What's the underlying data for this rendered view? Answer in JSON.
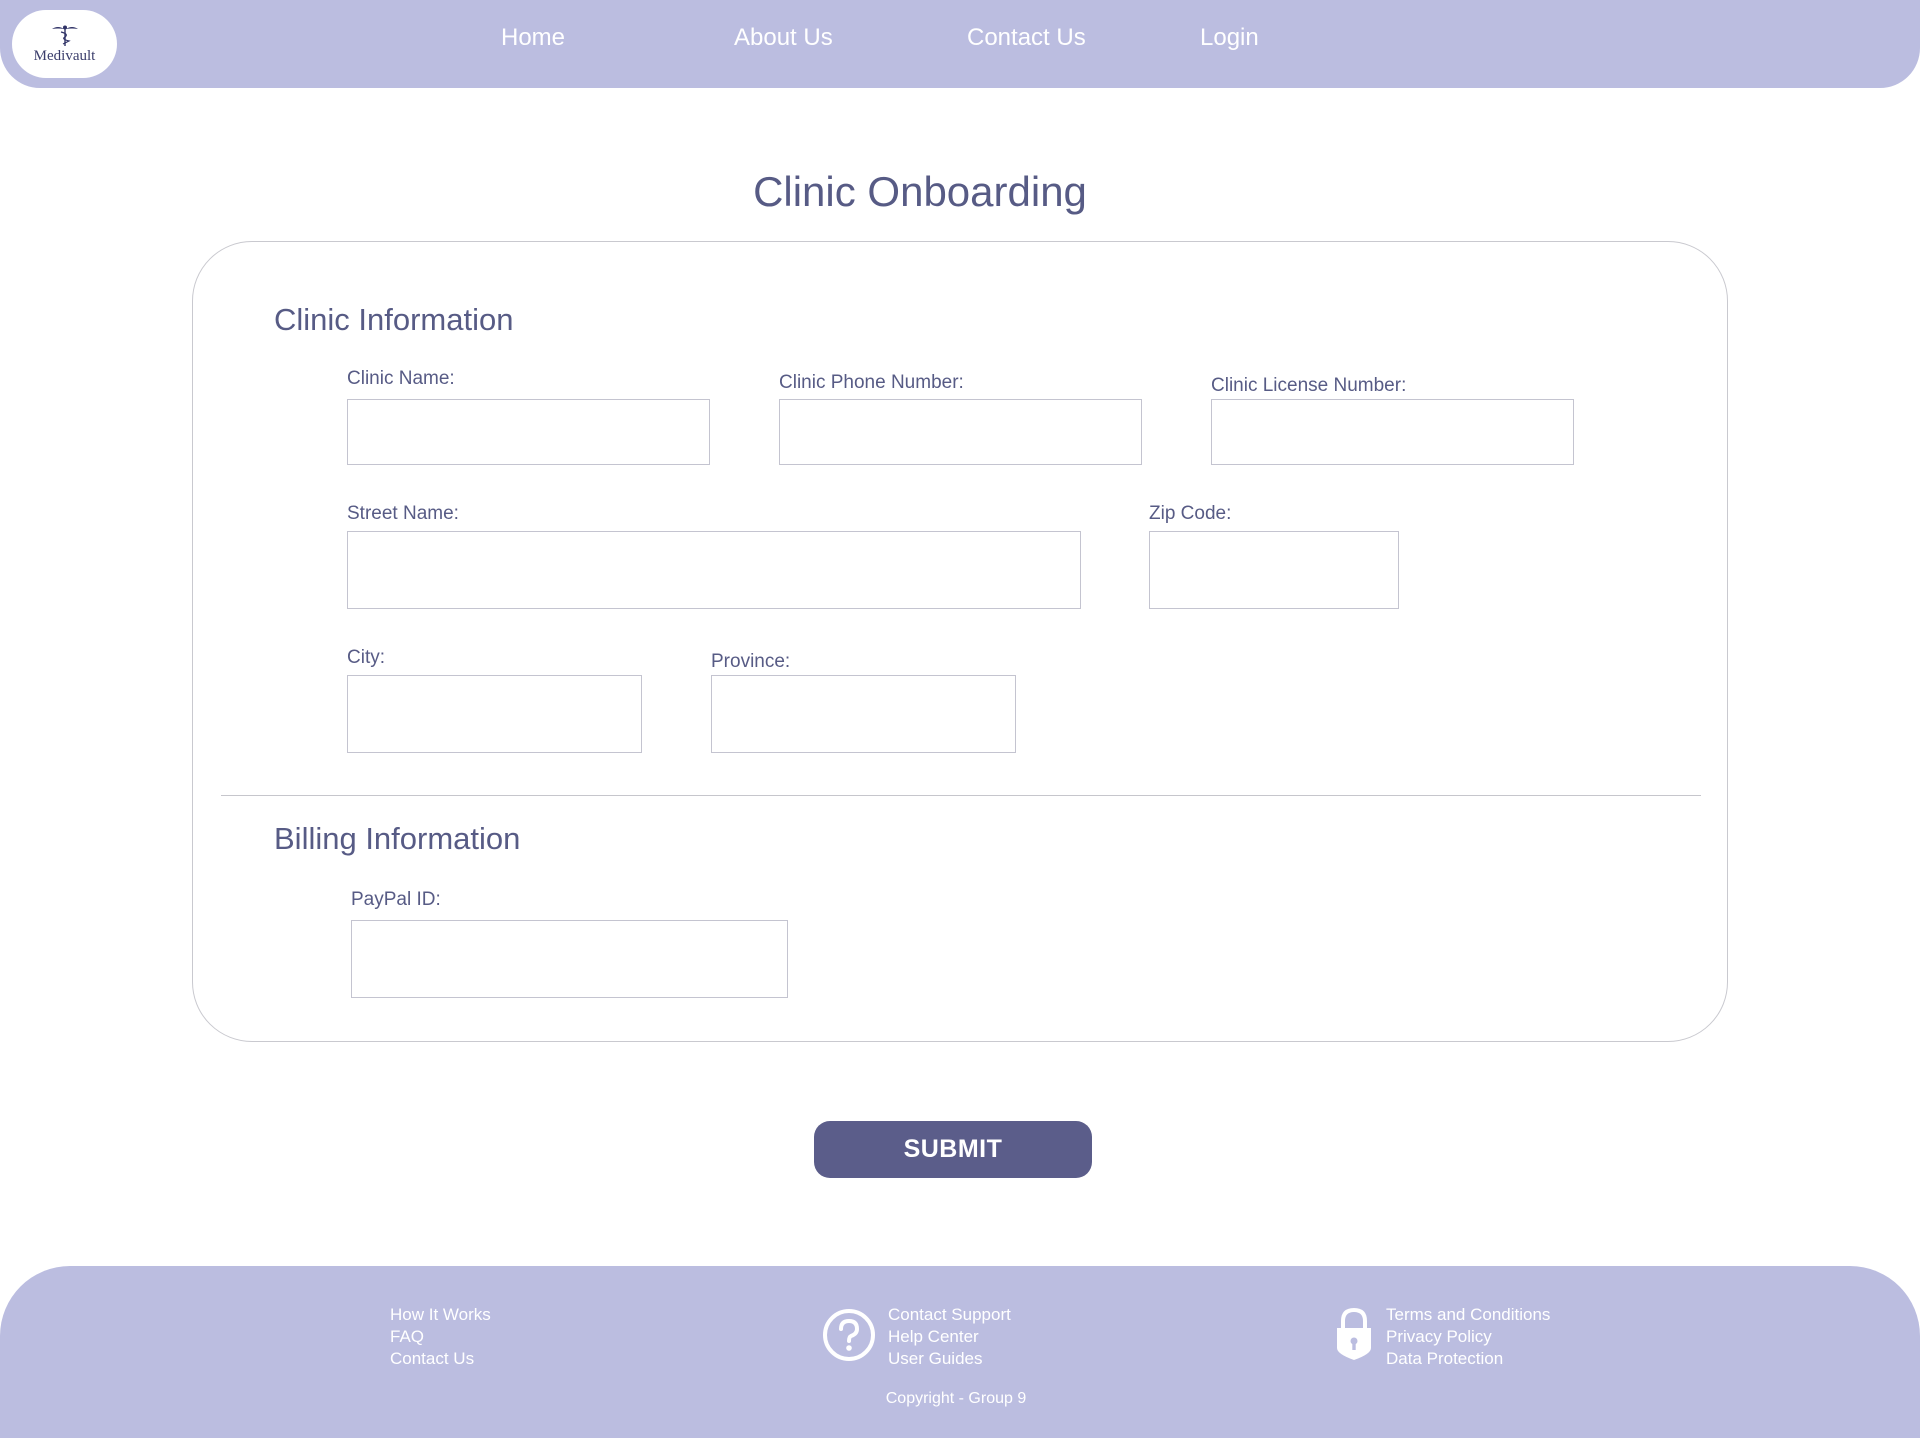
{
  "brand": {
    "name": "Medivault"
  },
  "nav": {
    "items": [
      {
        "label": "Home"
      },
      {
        "label": "About Us"
      },
      {
        "label": "Contact Us"
      },
      {
        "label": "Login"
      }
    ]
  },
  "page": {
    "title": "Clinic Onboarding"
  },
  "clinic_section": {
    "title": "Clinic Information",
    "fields": {
      "clinic_name": {
        "label": "Clinic Name:",
        "value": ""
      },
      "clinic_phone": {
        "label": "Clinic Phone Number:",
        "value": ""
      },
      "clinic_license": {
        "label": "Clinic License Number:",
        "value": ""
      },
      "street_name": {
        "label": "Street Name:",
        "value": ""
      },
      "zip_code": {
        "label": "Zip Code:",
        "value": ""
      },
      "city": {
        "label": "City:",
        "value": ""
      },
      "province": {
        "label": "Province:",
        "value": ""
      }
    }
  },
  "billing_section": {
    "title": "Billing Information",
    "fields": {
      "paypal_id": {
        "label": "PayPal ID:",
        "value": ""
      }
    }
  },
  "submit": {
    "label": "SUBMIT"
  },
  "footer": {
    "col1": [
      "How It Works",
      "FAQ",
      "Contact Us"
    ],
    "col2": [
      "Contact Support",
      "Help Center",
      "User Guides"
    ],
    "col3": [
      "Terms and Conditions",
      "Privacy Policy",
      "Data Protection"
    ],
    "icons": {
      "help": "question-circle-icon",
      "security": "padlock-icon"
    },
    "copyright": "Copyright - Group 9"
  },
  "colors": {
    "header_bg": "#bbbde0",
    "footer_bg": "#bbbde0",
    "primary_text": "#575b85",
    "button_bg": "#5b5d8a"
  }
}
